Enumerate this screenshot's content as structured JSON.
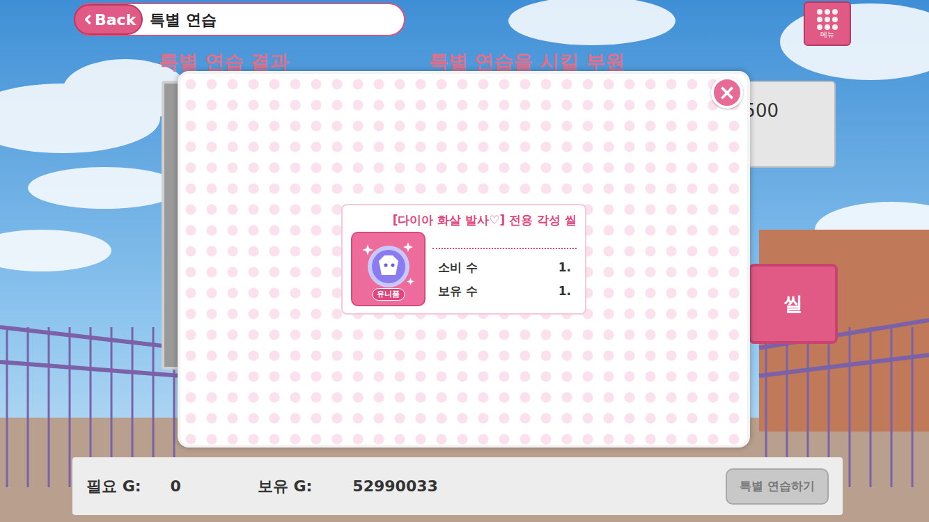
{
  "header": {
    "back_button": "Back",
    "title": "특별 연습",
    "menu_button": "메뉴"
  },
  "sections": [
    "특별 연습 결과",
    "특별 연습을 시킬 부원"
  ],
  "behind": {
    "value_partial": "500",
    "seal_button": "씰"
  },
  "footer": {
    "required_label": "필요 G:",
    "required_value": "0",
    "owned_label": "보유 G:",
    "owned_value": "52990033",
    "practice_button": {
      "label": "특별 연습하기",
      "disabled": true
    }
  },
  "dialog": {
    "close": "×",
    "item": {
      "name": "[다이아 화살 발사♡] 전용 각성 씰",
      "badge": "유니폼",
      "stats": [
        {
          "label": "소비 수",
          "value": "1."
        },
        {
          "label": "보유 수",
          "value": "1."
        }
      ]
    }
  }
}
